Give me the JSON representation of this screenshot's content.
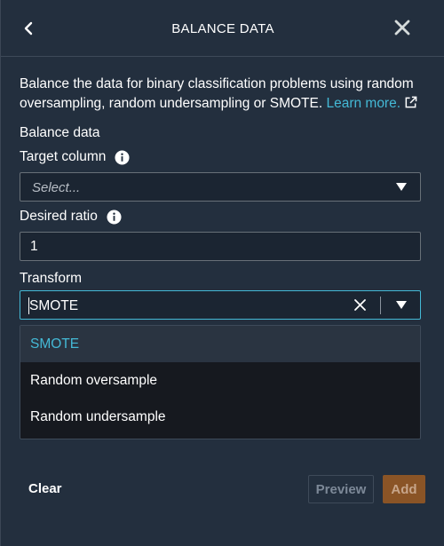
{
  "header": {
    "title": "BALANCE DATA",
    "back_icon": "chevron-left-icon",
    "close_icon": "close-icon"
  },
  "description": {
    "text": "Balance the data for binary classification problems using random oversampling, random undersampling or SMOTE.",
    "link_text": "Learn more.",
    "link_icon": "external-link-icon"
  },
  "form": {
    "section_label": "Balance data",
    "target_column": {
      "label": "Target column",
      "placeholder": "Select..."
    },
    "desired_ratio": {
      "label": "Desired ratio",
      "value": "1"
    },
    "transform": {
      "label": "Transform",
      "value": "SMOTE",
      "options": [
        "SMOTE",
        "Random oversample",
        "Random undersample"
      ],
      "selected_index": 0
    }
  },
  "footer": {
    "clear_label": "Clear",
    "preview_label": "Preview",
    "add_label": "Add"
  },
  "colors": {
    "background": "#232f3e",
    "accent": "#44b9d6",
    "primary_button": "#8a5426"
  }
}
